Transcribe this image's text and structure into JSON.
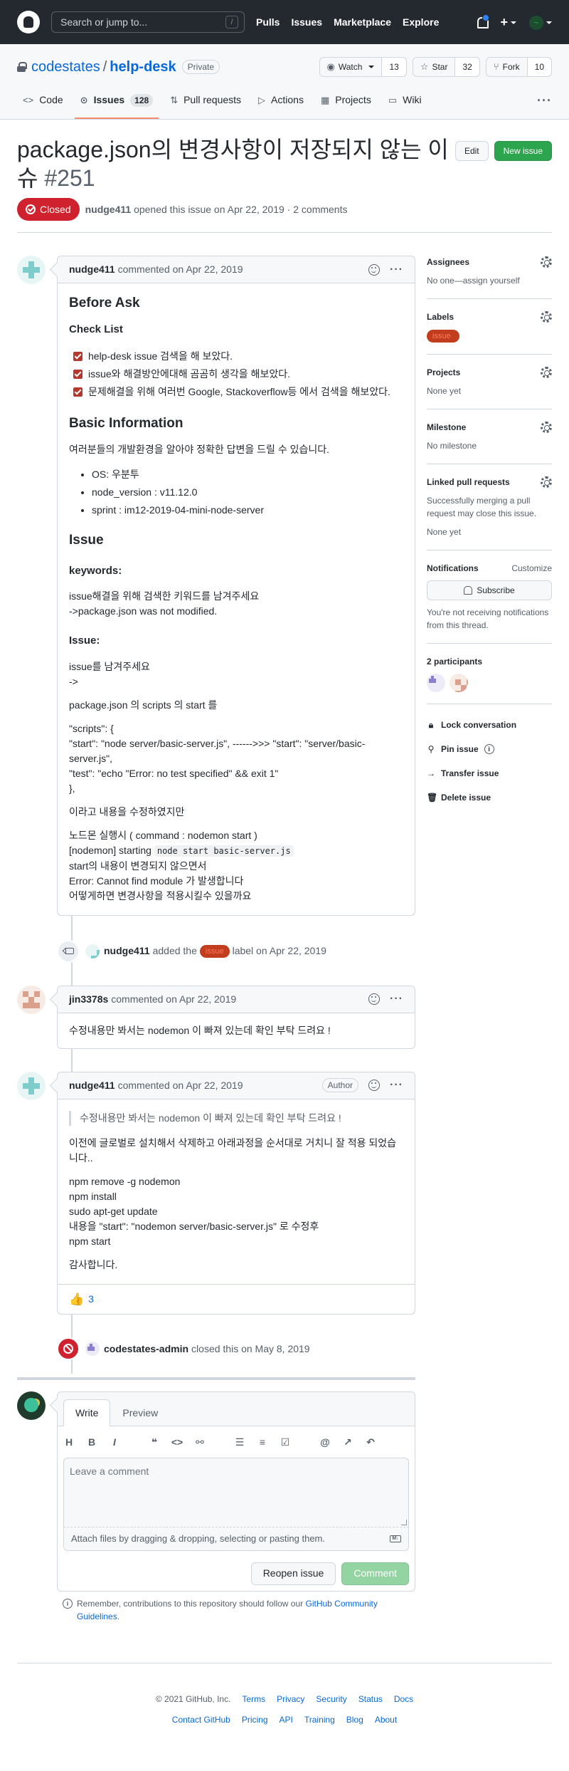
{
  "header": {
    "search_placeholder": "Search or jump to...",
    "search_shortcut": "/",
    "nav": [
      "Pulls",
      "Issues",
      "Marketplace",
      "Explore"
    ]
  },
  "repo": {
    "owner": "codestates",
    "separator": "/",
    "name": "help-desk",
    "visibility": "Private",
    "watch_label": "Watch",
    "watch_count": "13",
    "star_label": "Star",
    "star_count": "32",
    "fork_label": "Fork",
    "fork_count": "10",
    "tabs": [
      {
        "label": "Code",
        "icon": "code-icon"
      },
      {
        "label": "Issues",
        "icon": "issue-icon",
        "count": "128"
      },
      {
        "label": "Pull requests",
        "icon": "pull-request-icon"
      },
      {
        "label": "Actions",
        "icon": "actions-icon"
      },
      {
        "label": "Projects",
        "icon": "projects-icon"
      },
      {
        "label": "Wiki",
        "icon": "book-icon"
      }
    ]
  },
  "issue": {
    "title": "package.json의 변경사항이 저장되지 않는 이슈",
    "number": "#251",
    "edit_label": "Edit",
    "new_issue_label": "New issue",
    "state": "Closed",
    "author": "nudge411",
    "meta": "opened this issue on Apr 22, 2019 · 2 comments"
  },
  "comments": [
    {
      "author": "nudge411",
      "action": "commented on Apr 22, 2019",
      "body": {
        "h_before_ask": "Before Ask",
        "h_checklist": "Check List",
        "tasks": [
          "help-desk issue 검색을 해 보았다.",
          "issue와 해결방안에대해 곰곰히 생각을 해보았다.",
          "문제해결을 위해 여러번 Google, Stackoverflow등 에서 검색을 해보았다."
        ],
        "h_basic": "Basic Information",
        "basic_desc": "여러분들의 개발환경을 알아야 정확한 답변을 드릴 수 있습니다.",
        "basic_items": [
          "OS: 우분투",
          "node_version : v11.12.0",
          "sprint : im12-2019-04-mini-node-server"
        ],
        "h_issue": "Issue",
        "h_keywords": "keywords:",
        "kw_line1": "issue해결을 위해 검색한 키워드를 남겨주세요",
        "kw_line2": "->package.json was not modified.",
        "h_issue2": "Issue:",
        "is_line1": "issue를 남겨주세요",
        "is_line2": "->",
        "scripts_intro": "package.json 의 scripts 의 start 를",
        "code_line1": "\"scripts\": {",
        "code_line2": "\"start\": \"node server/basic-server.js\", ------>>> \"start\": \"server/basic-server.js\",",
        "code_line3": "\"test\": \"echo \"Error: no test specified\" && exit 1\"",
        "code_line4": "},",
        "modified": "이라고 내용을 수정하였지만",
        "run_line1": "노드몬 실행시 ( command : nodemon start )",
        "run_line2_prefix": "[nodemon] starting",
        "run_line2_code": "node start basic-server.js",
        "run_line3": "start의 내용이 변경되지 않으면서",
        "run_line4": "Error: Cannot find module 가 발생합니다",
        "run_line5": "어떻게하면 변경사항을 적용시킬수 있을까요"
      }
    },
    {
      "author": "jin3378s",
      "action": "commented on Apr 22, 2019",
      "text": "수정내용만 봐서는 nodemon 이 빠져 있는데 확인 부탁 드려요 !"
    },
    {
      "author": "nudge411",
      "action": "commented on Apr 22, 2019",
      "badge": "Author",
      "quote": "수정내용만 봐서는 nodemon 이 빠져 있는데 확인 부탁 드려요 !",
      "p1": "이전에 글로벌로 설치해서 삭제하고 아래과정을 순서대로 거치니 잘 적용 되었습니다..",
      "steps": [
        "npm remove -g nodemon",
        "npm install",
        "sudo apt-get update",
        "내용을 \"start\": \"nodemon server/basic-server.js\" 로 수정후",
        "npm start"
      ],
      "thanks": "감사합니다.",
      "reaction_count": "3"
    }
  ],
  "events": {
    "label_author": "nudge411",
    "label_pre": "added the",
    "label_name": "issue",
    "label_post": "label on Apr 22, 2019",
    "closed_author": "codestates-admin",
    "closed_text": "closed this on May 8, 2019"
  },
  "composer": {
    "tab_write": "Write",
    "tab_preview": "Preview",
    "placeholder": "Leave a comment",
    "attach": "Attach files by dragging & dropping, selecting or pasting them.",
    "reopen": "Reopen issue",
    "comment": "Comment",
    "guide_pre": "Remember, contributions to this repository should follow our",
    "guide_link": "GitHub Community Guidelines",
    "guide_post": "."
  },
  "sidebar": {
    "assignees_title": "Assignees",
    "assignees_value": "No one—assign yourself",
    "labels_title": "Labels",
    "label_name": "issue",
    "projects_title": "Projects",
    "projects_value": "None yet",
    "milestone_title": "Milestone",
    "milestone_value": "No milestone",
    "linked_title": "Linked pull requests",
    "linked_desc": "Successfully merging a pull request may close this issue.",
    "linked_value": "None yet",
    "notifications_title": "Notifications",
    "customize": "Customize",
    "subscribe": "Subscribe",
    "notif_desc": "You're not receiving notifications from this thread.",
    "participants_title": "2 participants",
    "actions": [
      "Lock conversation",
      "Pin issue",
      "Transfer issue",
      "Delete issue"
    ]
  },
  "footer": {
    "copyright": "© 2021 GitHub, Inc.",
    "row1": [
      "Terms",
      "Privacy",
      "Security",
      "Status",
      "Docs"
    ],
    "row2": [
      "Contact GitHub",
      "Pricing",
      "API",
      "Training",
      "Blog",
      "About"
    ]
  },
  "colors": {
    "closed": "#cf222e",
    "green": "#2da44e",
    "label": "#c23c1e",
    "link": "#0969da"
  }
}
